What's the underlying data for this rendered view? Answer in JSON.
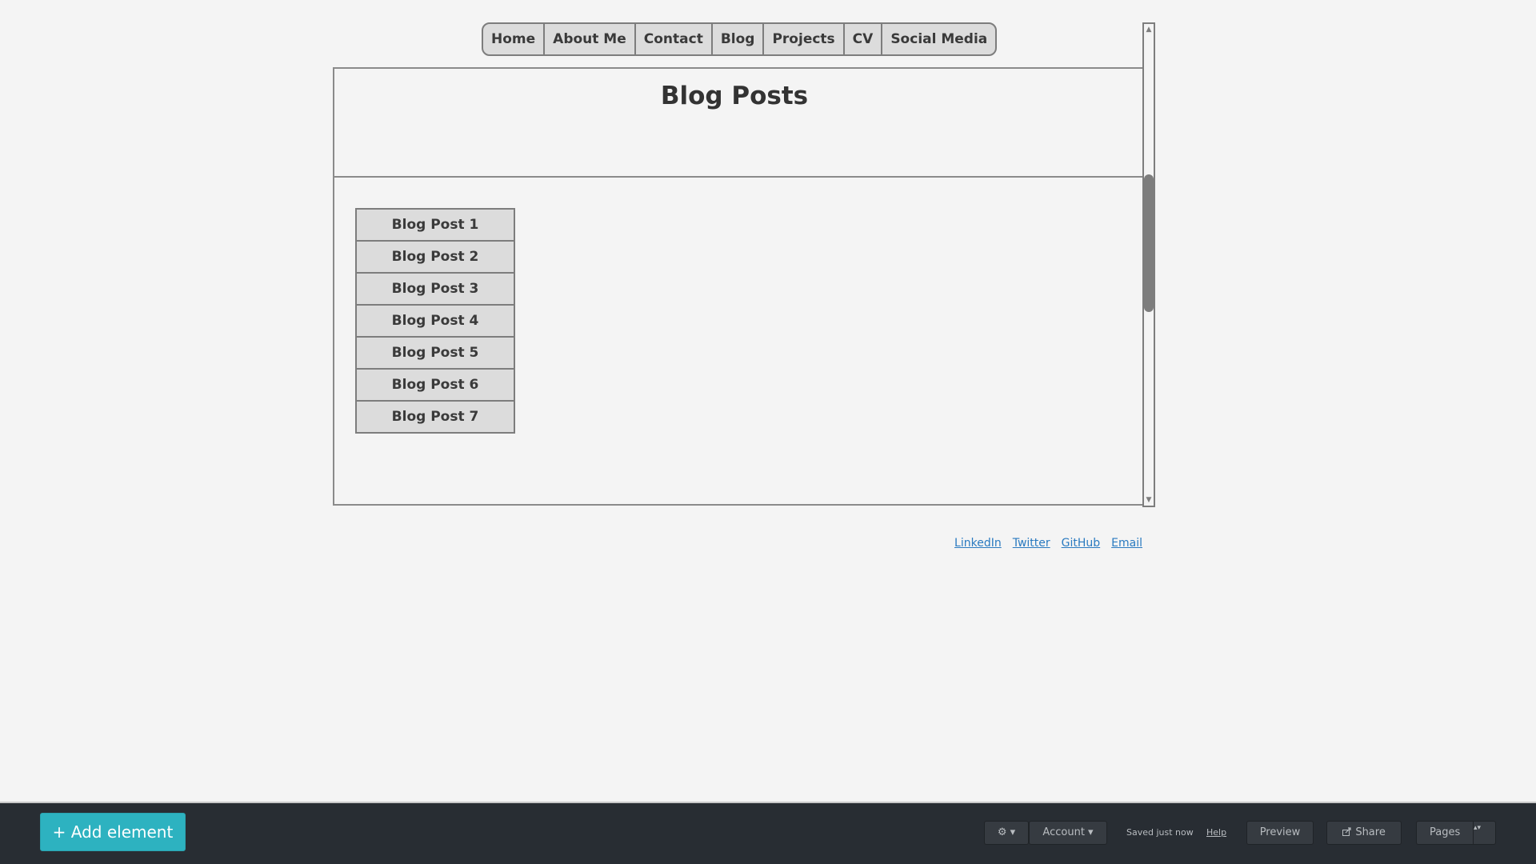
{
  "nav": {
    "items": [
      {
        "label": "Home"
      },
      {
        "label": "About Me"
      },
      {
        "label": "Contact"
      },
      {
        "label": "Blog"
      },
      {
        "label": "Projects"
      },
      {
        "label": "CV"
      },
      {
        "label": "Social Media"
      }
    ]
  },
  "header": {
    "title": "Blog Posts"
  },
  "blog": {
    "posts": [
      {
        "label": "Blog Post 1"
      },
      {
        "label": "Blog Post 2"
      },
      {
        "label": "Blog Post 3"
      },
      {
        "label": "Blog Post 4"
      },
      {
        "label": "Blog Post 5"
      },
      {
        "label": "Blog Post 6"
      },
      {
        "label": "Blog Post 7"
      }
    ]
  },
  "scrollbar": {
    "up_glyph": "▲",
    "down_glyph": "▼"
  },
  "footer": {
    "links": [
      {
        "label": "LinkedIn"
      },
      {
        "label": "Twitter"
      },
      {
        "label": "GitHub"
      },
      {
        "label": "Email"
      }
    ]
  },
  "editor": {
    "add_element_label": "+ Add element",
    "settings_label": "⚙ ▾",
    "account_label": "Account ▾",
    "saved_status": "Saved just now",
    "help_label": "Help",
    "preview_label": "Preview",
    "share_label": "Share",
    "pages_label": "Pages",
    "pages_stepper": "▴▾"
  },
  "colors": {
    "accent": "#2db2c0",
    "link": "#2a7ac0",
    "bar_background": "#282d33",
    "page_background": "#f4f4f4"
  },
  "icons": {
    "settings": "gear-icon",
    "share": "share-icon"
  }
}
